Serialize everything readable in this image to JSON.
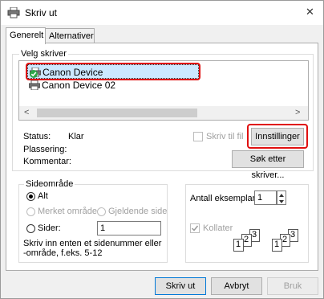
{
  "window": {
    "title": "Skriv ut",
    "close_glyph": "✕"
  },
  "tabs": [
    {
      "label": "Generelt"
    },
    {
      "label": "Alternativer"
    }
  ],
  "select_printer": {
    "legend": "Velg skriver",
    "printers": [
      {
        "name": "Canon Device",
        "selected": true,
        "is_default": true
      },
      {
        "name": "Canon Device 02",
        "selected": false,
        "is_default": false
      }
    ],
    "scroll_left": "<",
    "scroll_right": ">",
    "status_label": "Status:",
    "status_value": "Klar",
    "location_label": "Plassering:",
    "location_value": "",
    "comment_label": "Kommentar:",
    "comment_value": "",
    "print_to_file_label": "Skriv til fil",
    "print_to_file_checked": false,
    "settings_button": "Innstillinger",
    "find_printer_button": "Søk etter skriver..."
  },
  "page_range": {
    "legend": "Sideområde",
    "all_label": "Alt",
    "selection_label": "Merket område",
    "current_page_label": "Gjeldende side",
    "pages_label": "Sider:",
    "pages_value": "1",
    "hint": "Skriv inn enten et sidenummer eller -område, f.eks. 5-12"
  },
  "copies": {
    "count_label": "Antall eksemplarer:",
    "count_value": "1",
    "collate_label": "Kollater",
    "collate_checked": true,
    "collate_icon_digits": [
      "1",
      "2",
      "3"
    ]
  },
  "footer": {
    "print_button": "Skriv ut",
    "cancel_button": "Avbryt",
    "apply_button": "Bruk"
  },
  "colors": {
    "accent": "#0078d7",
    "selected_row": "#cce8ff",
    "highlight_red": "#e01010",
    "default_check": "#2da84a"
  }
}
